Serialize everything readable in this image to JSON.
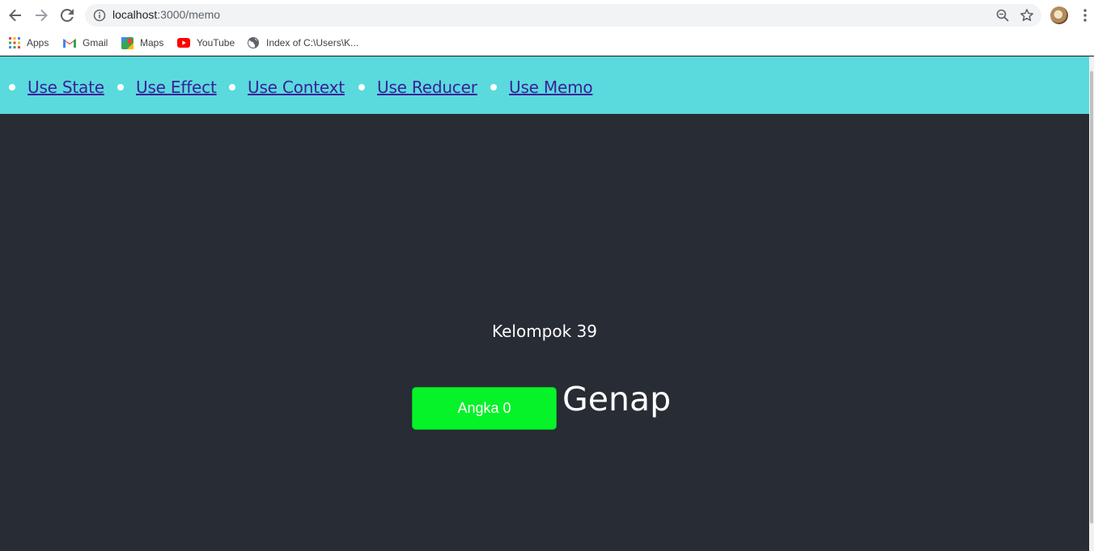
{
  "browser": {
    "url_host": "localhost",
    "url_path": ":3000/memo",
    "nav": {
      "back_icon": "arrow-left-icon",
      "forward_icon": "arrow-right-icon",
      "reload_icon": "reload-icon"
    },
    "bookmarks": [
      {
        "label": "Apps",
        "icon": "apps-grid-icon"
      },
      {
        "label": "Gmail",
        "icon": "gmail-icon"
      },
      {
        "label": "Maps",
        "icon": "maps-icon"
      },
      {
        "label": "YouTube",
        "icon": "youtube-icon"
      },
      {
        "label": "Index of C:\\Users\\K...",
        "icon": "globe-icon"
      }
    ]
  },
  "page": {
    "nav_links": [
      "Use State",
      "Use Effect",
      "Use Context",
      "Use Reducer",
      "Use Memo"
    ],
    "group_title": "Kelompok 39",
    "counter_button": "Angka 0",
    "result_text": "Genap",
    "colors": {
      "navbar": "#5adadc",
      "background": "#282c34",
      "button": "#06f229",
      "link": "#3b1f9c"
    }
  }
}
